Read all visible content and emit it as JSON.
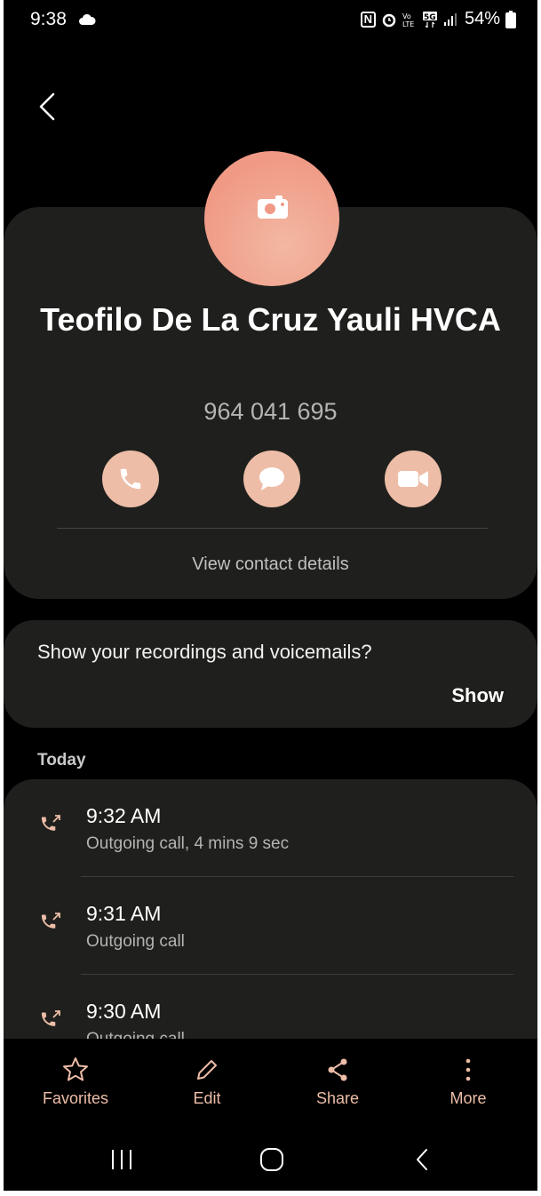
{
  "status_bar": {
    "time": "9:38",
    "battery": "54%",
    "icons": [
      "cloud-icon",
      "nfc-icon",
      "alarm-icon",
      "volte-icon",
      "5g-icon",
      "signal-icon",
      "battery-icon"
    ]
  },
  "contact": {
    "name": "Teofilo De La Cruz Yauli HVCA",
    "number": "964 041 695",
    "view_details": "View contact details",
    "actions": [
      "phone-icon",
      "message-icon",
      "video-call-icon"
    ]
  },
  "recordings": {
    "prompt": "Show your recordings and voicemails?",
    "show_label": "Show"
  },
  "call_log": {
    "section_label": "Today",
    "items": [
      {
        "time": "9:32 AM",
        "description": "Outgoing call, 4 mins 9 sec"
      },
      {
        "time": "9:31 AM",
        "description": "Outgoing call"
      },
      {
        "time": "9:30 AM",
        "description": "Outgoing call"
      }
    ]
  },
  "toolbar": {
    "favorites": "Favorites",
    "edit": "Edit",
    "share": "Share",
    "more": "More"
  },
  "colors": {
    "accent": "#edbda7",
    "avatar": "#f09a86",
    "card": "#1f201d",
    "background": "#000000"
  }
}
